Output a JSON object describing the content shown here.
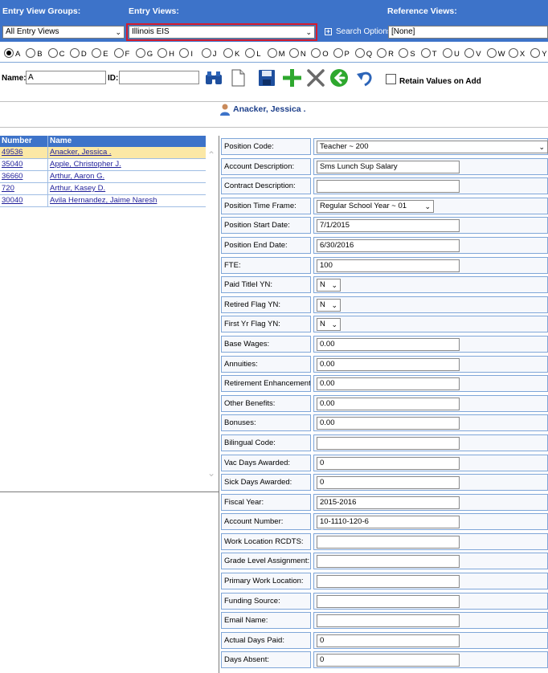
{
  "header": {
    "entry_view_groups_label": "Entry View Groups:",
    "entry_views_label": "Entry Views:",
    "reference_views_label": "Reference Views:",
    "entry_view_groups_value": "All Entry Views",
    "entry_views_value": "Illinois EIS",
    "search_options": "Search Options",
    "reference_views_value": "[None]"
  },
  "alphabet": [
    "A",
    "B",
    "C",
    "D",
    "E",
    "F",
    "G",
    "H",
    "I",
    "J",
    "K",
    "L",
    "M",
    "N",
    "O",
    "P",
    "Q",
    "R",
    "S",
    "T",
    "U",
    "V",
    "W",
    "X",
    "Y"
  ],
  "alphabet_selected": "A",
  "toolbar": {
    "name_label": "Name:",
    "name_value": "A",
    "id_label": "ID:",
    "id_value": "",
    "retain_label": "Retain Values on Add"
  },
  "selected_person": "Anacker, Jessica .",
  "list": {
    "headers": [
      "Number",
      "Name"
    ],
    "rows": [
      {
        "number": "49536",
        "name": "Anacker, Jessica ."
      },
      {
        "number": "35040",
        "name": "Apple, Christopher J."
      },
      {
        "number": "36660",
        "name": "Arthur, Aaron G."
      },
      {
        "number": "720",
        "name": "Arthur, Kasey D."
      },
      {
        "number": "30040",
        "name": "Avila Hernandez, Jaime Naresh"
      }
    ]
  },
  "form": {
    "fields": [
      {
        "label": "Position Code:",
        "value": "Teacher ~ 200",
        "type": "select-wide"
      },
      {
        "label": "Account Description:",
        "value": "Sms Lunch Sup Salary",
        "type": "text"
      },
      {
        "label": "Contract Description:",
        "value": "",
        "type": "text"
      },
      {
        "label": "Position Time Frame:",
        "value": "Regular School Year ~ 01",
        "type": "select-mid"
      },
      {
        "label": "Position Start Date:",
        "value": "7/1/2015",
        "type": "text"
      },
      {
        "label": "Position End Date:",
        "value": "6/30/2016",
        "type": "text"
      },
      {
        "label": "FTE:",
        "value": "100",
        "type": "text"
      },
      {
        "label": "Paid TitleI YN:",
        "value": "N",
        "type": "select-small"
      },
      {
        "label": "Retired Flag YN:",
        "value": "N",
        "type": "select-small"
      },
      {
        "label": "First Yr Flag YN:",
        "value": "N",
        "type": "select-small"
      },
      {
        "label": "Base Wages:",
        "value": "0.00",
        "type": "text"
      },
      {
        "label": "Annuities:",
        "value": "0.00",
        "type": "text"
      },
      {
        "label": "Retirement Enhancements:",
        "value": "0.00",
        "type": "text"
      },
      {
        "label": "Other Benefits:",
        "value": "0.00",
        "type": "text"
      },
      {
        "label": "Bonuses:",
        "value": "0.00",
        "type": "text"
      },
      {
        "label": "Bilingual Code:",
        "value": "",
        "type": "text"
      },
      {
        "label": "Vac Days Awarded:",
        "value": "0",
        "type": "text"
      },
      {
        "label": "Sick Days Awarded:",
        "value": "0",
        "type": "text"
      },
      {
        "label": "Fiscal Year:",
        "value": "2015-2016",
        "type": "text"
      },
      {
        "label": "Account Number:",
        "value": "10-1110-120-6",
        "type": "text"
      },
      {
        "label": "Work Location RCDTS:",
        "value": "",
        "type": "text"
      },
      {
        "label": "Grade Level Assignment:",
        "value": "",
        "type": "text"
      },
      {
        "label": "Primary Work Location:",
        "value": "",
        "type": "text"
      },
      {
        "label": "Funding Source:",
        "value": "",
        "type": "text"
      },
      {
        "label": "Email Name:",
        "value": "",
        "type": "text"
      },
      {
        "label": "Actual Days Paid:",
        "value": "0",
        "type": "text"
      },
      {
        "label": "Days Absent:",
        "value": "0",
        "type": "text"
      }
    ]
  },
  "icons": [
    "binoculars-icon",
    "new-document-icon",
    "save-icon",
    "add-icon",
    "delete-icon",
    "back-icon",
    "undo-icon",
    "person-icon"
  ],
  "colors": {
    "header_blue": "#3d73c9",
    "highlight_red": "#d61c2c",
    "selected_row": "#fbe8a6",
    "add_green": "#2ea82e"
  }
}
